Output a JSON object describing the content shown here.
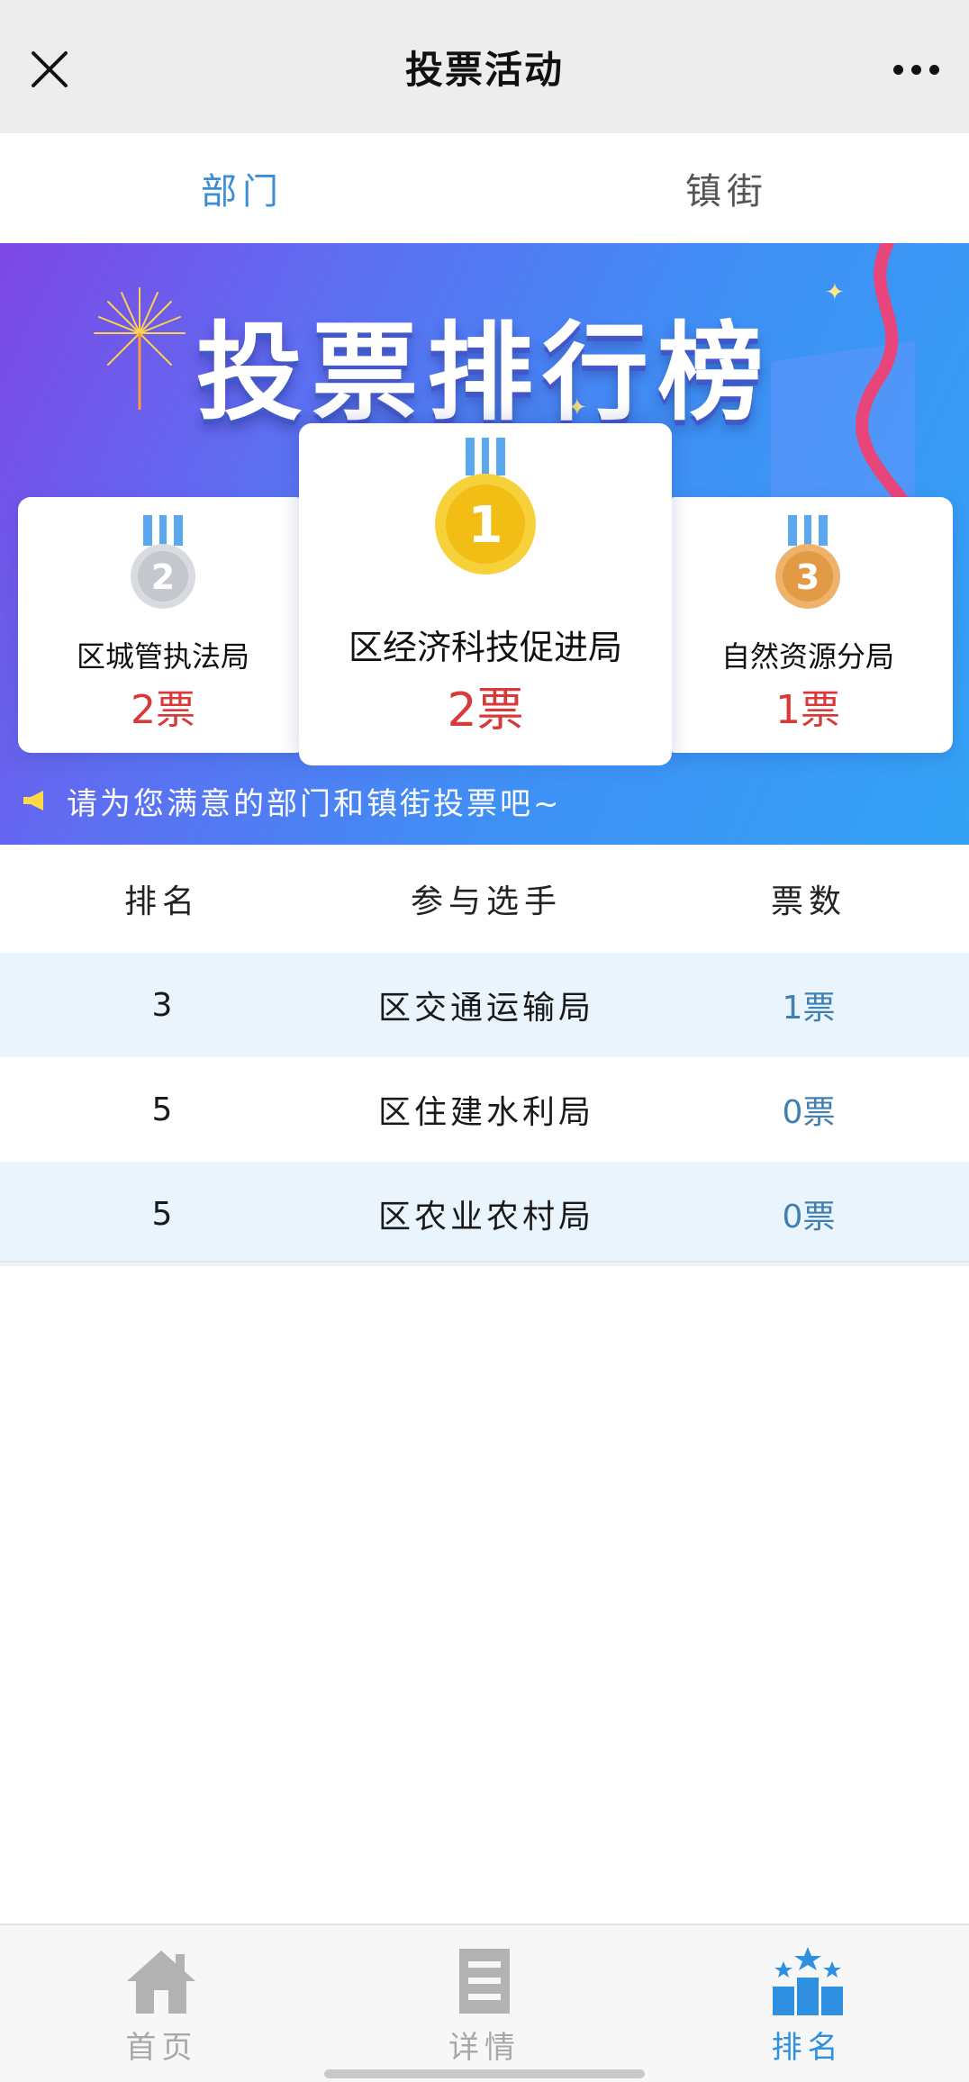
{
  "navbar": {
    "title": "投票活动",
    "close_icon": "close-icon",
    "more_icon": "more-dots-icon"
  },
  "tabs": [
    {
      "label": "部门",
      "active": true
    },
    {
      "label": "镇街",
      "active": false
    }
  ],
  "banner": {
    "title": "投票排行榜",
    "notice": "请为您满意的部门和镇街投票吧~",
    "podium": {
      "first": {
        "rank": "1",
        "name": "区经济科技促进局",
        "votes": "2票",
        "medal_color": "#f5c31c"
      },
      "second": {
        "rank": "2",
        "name": "区城管执法局",
        "votes": "2票",
        "medal_color": "#c9cdd3"
      },
      "third": {
        "rank": "3",
        "name": "自然资源分局",
        "votes": "1票",
        "medal_color": "#e5a24f"
      }
    }
  },
  "table": {
    "headers": {
      "rank": "排名",
      "name": "参与选手",
      "votes": "票数"
    },
    "rows": [
      {
        "rank": "3",
        "name": "区交通运输局",
        "votes": "1票"
      },
      {
        "rank": "5",
        "name": "区住建水利局",
        "votes": "0票"
      },
      {
        "rank": "5",
        "name": "区农业农村局",
        "votes": "0票"
      }
    ]
  },
  "bottom_nav": [
    {
      "label": "首页",
      "icon": "home-icon",
      "active": false
    },
    {
      "label": "详情",
      "icon": "details-icon",
      "active": false
    },
    {
      "label": "排名",
      "icon": "ranking-icon",
      "active": true
    }
  ],
  "colors": {
    "accent": "#3d8dd6",
    "votes_red": "#d83a3a",
    "row_alt": "#eaf4fc"
  }
}
